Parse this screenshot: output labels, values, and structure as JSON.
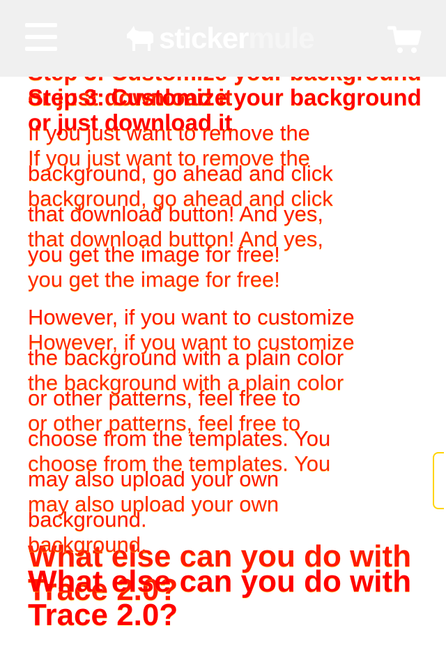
{
  "header": {
    "logo_text_main": "sticker",
    "logo_text_dim": "mule",
    "menu_icon": "hamburger-menu-icon",
    "cart_icon": "shopping-cart-icon",
    "logo_icon": "mule-logo-icon"
  },
  "colors": {
    "header_bg": "#f0f0f0",
    "text_red": "#ff0000",
    "text_orange_red": "#ff2a00",
    "scroll_accent": "#ffd400"
  },
  "article": {
    "step_heading": "Step 3: Customize your background or just download it",
    "paragraph_1": "If you just want to remove the\nbackground, go ahead and click\nthat download button! And yes,\nyou get the image for free!",
    "paragraph_2": "However, if you want to customize\nthe background with a plain color\nor other patterns, feel free to\nchoose from the templates. You\nmay also upload your own\nbackground.",
    "next_heading": "What else can you do with Trace 2.0?"
  }
}
